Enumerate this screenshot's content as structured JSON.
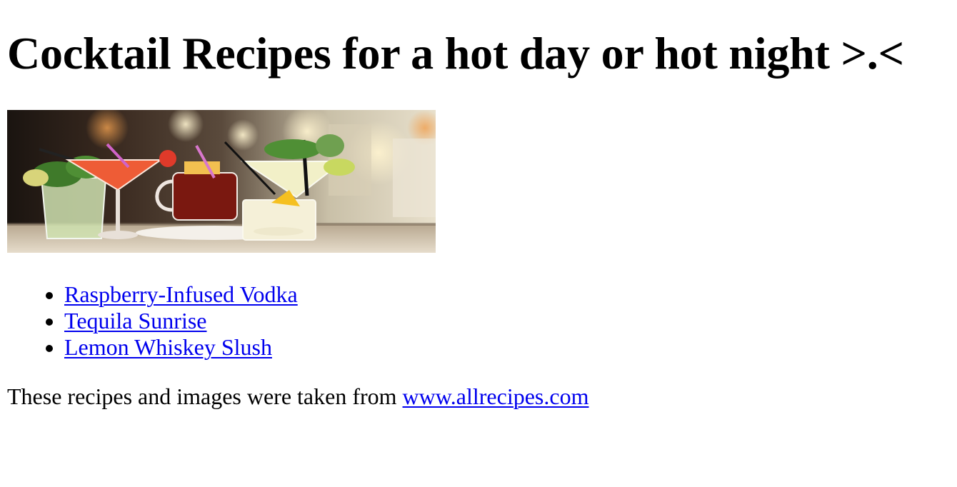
{
  "page": {
    "heading": "Cocktail Recipes for a hot day or hot night >.<"
  },
  "hero_image": {
    "alt": "Assorted cocktails on a bar counter"
  },
  "recipes": [
    {
      "label": "Raspberry-Infused Vodka"
    },
    {
      "label": "Tequila Sunrise"
    },
    {
      "label": "Lemon Whiskey Slush"
    }
  ],
  "credit": {
    "text": "These recipes and images were taken from ",
    "link_label": "www.allrecipes.com"
  },
  "colors": {
    "link": "#0000ee",
    "text": "#000000",
    "background": "#ffffff"
  }
}
